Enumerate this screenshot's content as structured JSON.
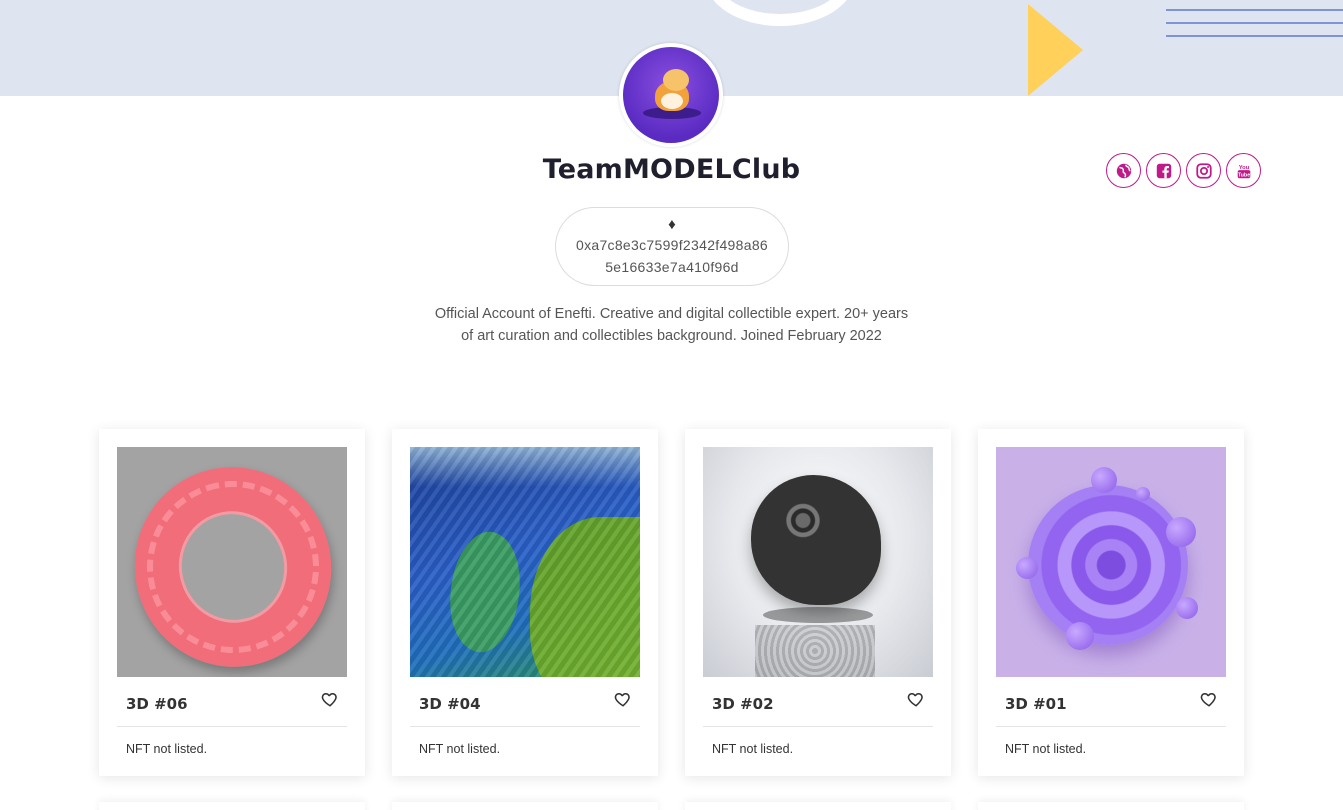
{
  "profile": {
    "name": "TeamMODELClub",
    "wallet_symbol": "♦",
    "wallet_address_line1": "0xa7c8e3c7599f2342f498a86",
    "wallet_address_line2": "5e16633e7a410f96d",
    "bio": "Official Account of Enefti. Creative and digital collectible expert. 20+ years of art curation and collectibles background. Joined February 2022"
  },
  "social_links": [
    {
      "icon": "globe-icon"
    },
    {
      "icon": "facebook-icon"
    },
    {
      "icon": "instagram-icon"
    },
    {
      "icon": "youtube-icon"
    }
  ],
  "colors": {
    "accent": "#c01a8a",
    "banner": "#dfe4f1",
    "banner_triangle": "#ffd05a"
  },
  "cards": [
    {
      "title": "3D #06",
      "status": "NFT not listed."
    },
    {
      "title": "3D #04",
      "status": "NFT not listed."
    },
    {
      "title": "3D #02",
      "status": "NFT not listed."
    },
    {
      "title": "3D #01",
      "status": "NFT not listed."
    }
  ]
}
